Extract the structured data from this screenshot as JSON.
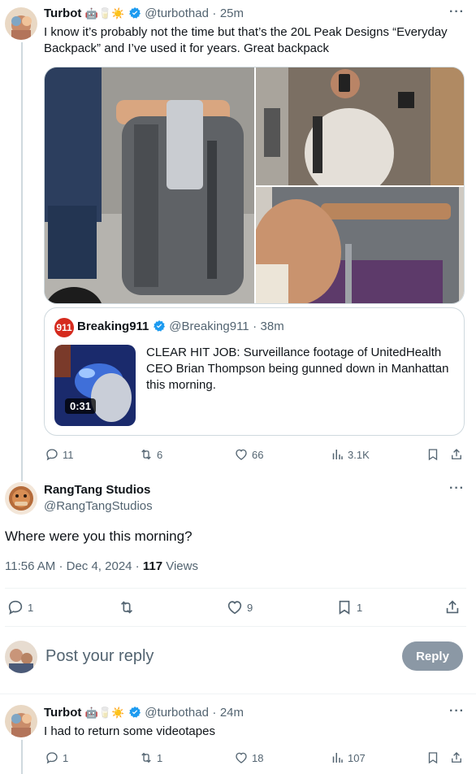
{
  "tweet1": {
    "name": "Turbot",
    "emojis": [
      "🤖",
      "🥛",
      "☀️"
    ],
    "handle": "@turbothad",
    "time": "25m",
    "text": "I know it’s probably not the time but that’s the 20L Peak Designs “Everyday Backpack” and I’ve used it for years. Great backpack",
    "quote": {
      "name": "Breaking911",
      "handle": "@Breaking911",
      "time": "38m",
      "text": "CLEAR HIT JOB: Surveillance footage of UnitedHealth CEO Brian Thompson being gunned down in Manhattan this morning.",
      "video_duration": "0:31"
    },
    "stats": {
      "replies": "11",
      "reposts": "6",
      "likes": "66",
      "views": "3.1K"
    }
  },
  "main": {
    "name": "RangTang Studios",
    "handle": "@RangTangStudios",
    "text": "Where were you this morning?",
    "time": "11:56 AM",
    "date": "Dec 4, 2024",
    "views_count": "117",
    "views_label": "Views",
    "stats": {
      "replies": "1",
      "reposts": "",
      "likes": "9",
      "bookmarks": "1"
    }
  },
  "reply_box": {
    "placeholder": "Post your reply",
    "button": "Reply"
  },
  "tweet2": {
    "name": "Turbot",
    "emojis": [
      "🤖",
      "🥛",
      "☀️"
    ],
    "handle": "@turbothad",
    "time": "24m",
    "text": "I had to return some videotapes",
    "stats": {
      "replies": "1",
      "reposts": "1",
      "likes": "18",
      "views": "107"
    }
  },
  "colors": {
    "verified": "#1d9bf0",
    "muted": "#536471",
    "border": "#cfd9de",
    "reply_button": "#8b98a5"
  }
}
